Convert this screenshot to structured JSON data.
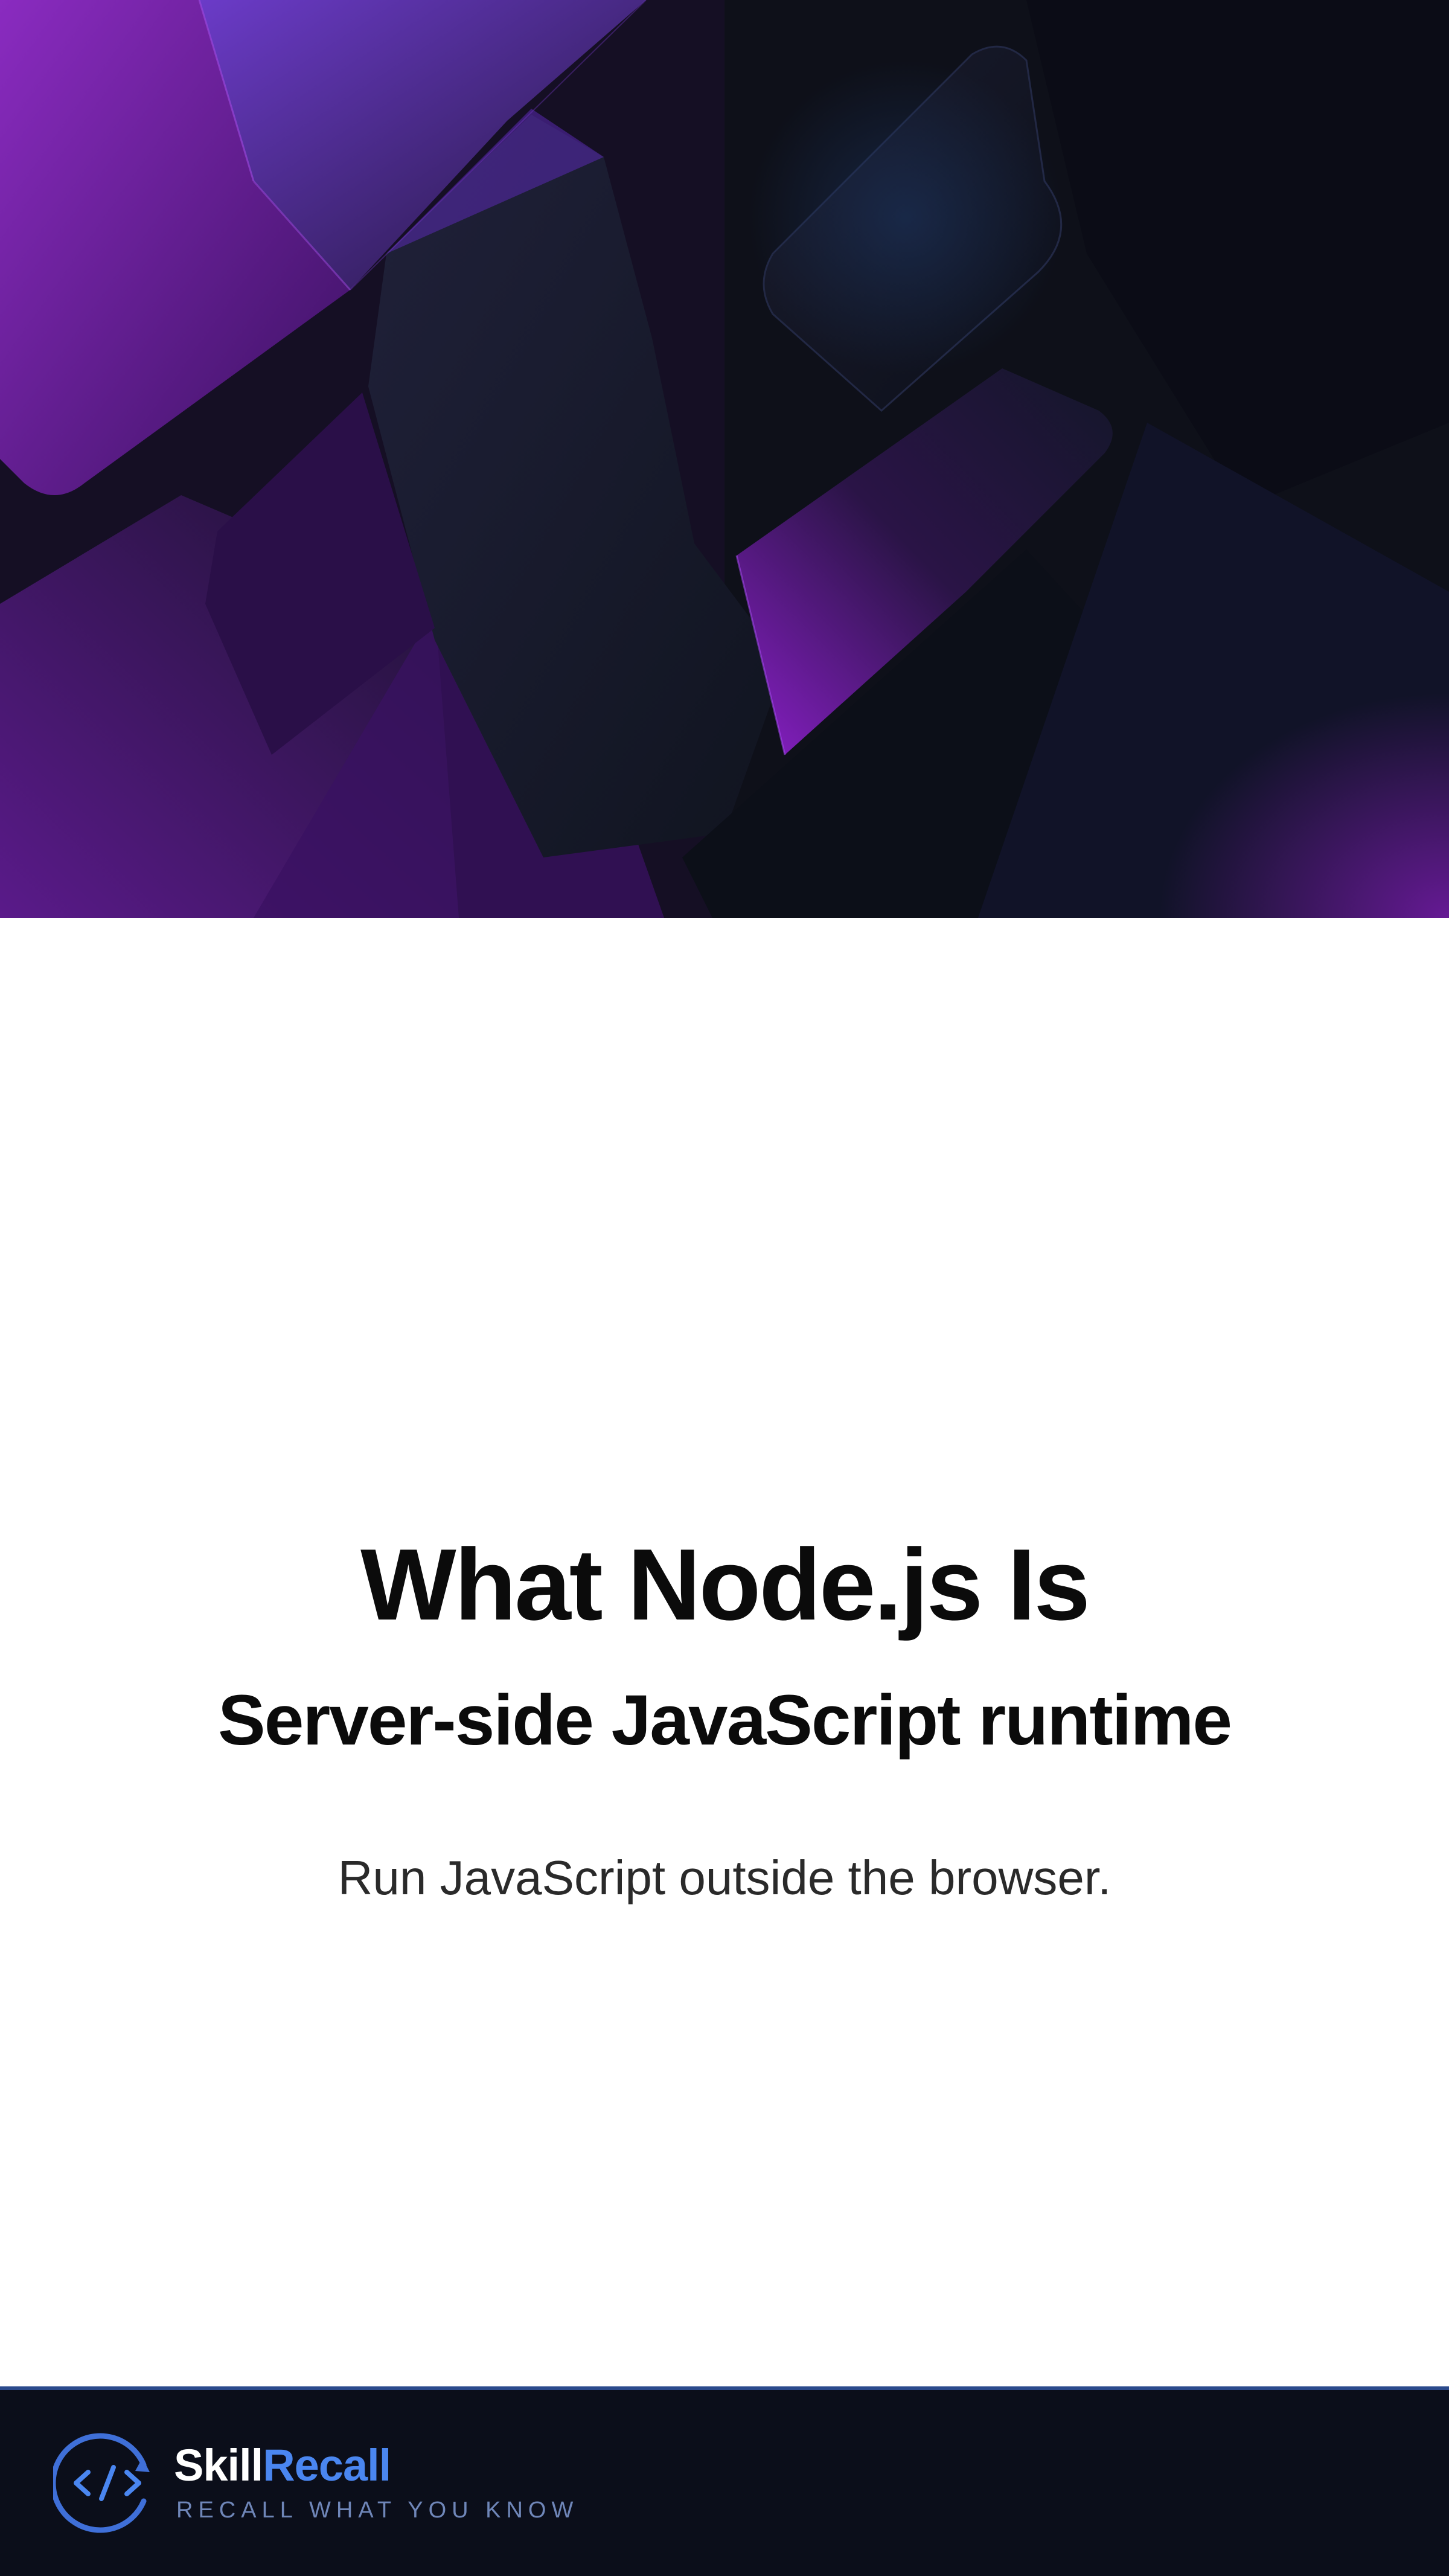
{
  "hero": {
    "background_icon": "abstract-geometric-shapes",
    "colors": {
      "purple": "#7a1fa8",
      "deep_purple": "#2a0f45",
      "navy": "#141a2a",
      "dark": "#0a0b14"
    }
  },
  "content": {
    "title": "What Node.js Is",
    "subtitle": "Server-side JavaScript runtime",
    "body": "Run JavaScript outside the browser."
  },
  "footer": {
    "logo_icon": "code-recall-icon",
    "brand_part1": "Skill",
    "brand_part2": "Recall",
    "tagline": "RECALL WHAT YOU KNOW",
    "colors": {
      "background": "#0b0e1a",
      "accent": "#4a86f0",
      "tagline": "#6f86b8"
    }
  }
}
